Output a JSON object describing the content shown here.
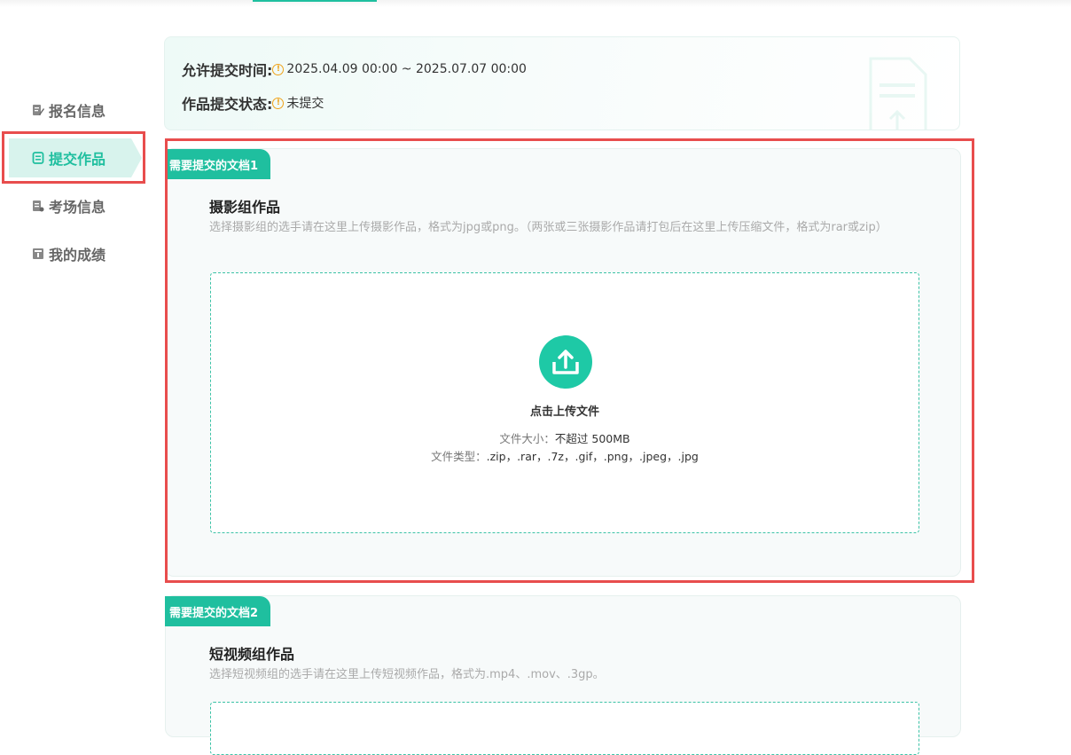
{
  "sidebar": {
    "items": [
      {
        "label": "报名信息",
        "icon": "edit-doc-icon",
        "active": false
      },
      {
        "label": "提交作品",
        "icon": "submit-doc-icon",
        "active": true
      },
      {
        "label": "考场信息",
        "icon": "exam-doc-icon",
        "active": false
      },
      {
        "label": "我的成绩",
        "icon": "score-icon",
        "active": false
      }
    ]
  },
  "info": {
    "time_label": "允许提交时间:",
    "time_value": "2025.04.09 00:00 ~ 2025.07.07 00:00",
    "status_label": "作品提交状态:",
    "status_value": "未提交",
    "warn_icon": "!"
  },
  "docs": [
    {
      "tag": "需要提交的文档1",
      "title": "摄影组作品",
      "desc": "选择摄影组的选手请在这里上传摄影作品，格式为jpg或png。（两张或三张摄影作品请打包后在这里上传压缩文件，格式为rar或zip）",
      "upload_text": "点击上传文件",
      "size_label": "文件大小：",
      "size_value": "不超过 500MB",
      "type_label": "文件类型：",
      "type_value": ".zip，.rar，.7z，.gif，.png，.jpeg，.jpg"
    },
    {
      "tag": "需要提交的文档2",
      "title": "短视频组作品",
      "desc": "选择短视频组的选手请在这里上传短视频作品，格式为.mp4、.mov、.3gp。"
    }
  ],
  "colors": {
    "accent": "#1fbf9f",
    "highlight": "#e84d4d",
    "warning": "#f0a31a"
  }
}
